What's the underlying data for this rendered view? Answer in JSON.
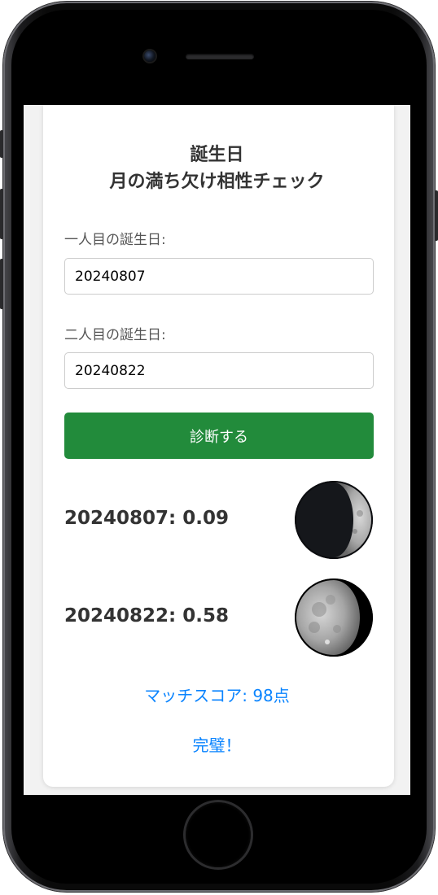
{
  "app": {
    "title_line1": "誕生日",
    "title_line2": "月の満ち欠け相性チェック"
  },
  "form": {
    "person1_label": "一人目の誕生日:",
    "person1_value": "20240807",
    "person2_label": "二人目の誕生日:",
    "person2_value": "20240822",
    "submit_label": "診断する"
  },
  "results": [
    {
      "date": "20240807",
      "phase": "0.09",
      "text": "20240807: 0.09",
      "moon_icon": "waxing-crescent-moon-icon"
    },
    {
      "date": "20240822",
      "phase": "0.58",
      "text": "20240822: 0.58",
      "moon_icon": "waning-gibbous-moon-icon"
    }
  ],
  "match": {
    "score_text": "マッチスコア: 98点",
    "verdict": "完璧！"
  },
  "colors": {
    "button_bg": "#228b3b",
    "accent_text": "#0a84ff",
    "heading_text": "#333333"
  }
}
